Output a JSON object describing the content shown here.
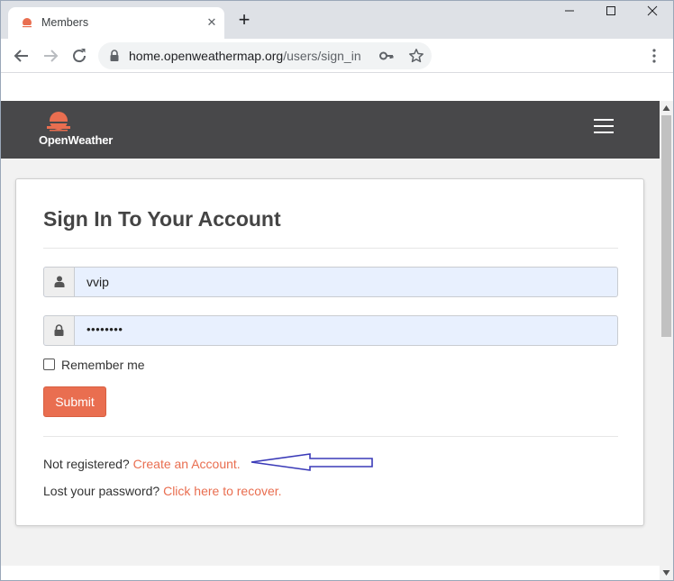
{
  "browser": {
    "tab_title": "Members",
    "url_domain": "home.openweathermap.org",
    "url_path": "/users/sign_in"
  },
  "site": {
    "logo_text": "OpenWeather",
    "brand_color": "#e96e50",
    "header_color": "#48484a"
  },
  "form": {
    "title": "Sign In To Your Account",
    "username_value": "vvip",
    "password_value": "••••••••",
    "remember_label": "Remember me",
    "submit_label": "Submit"
  },
  "footer_links": {
    "not_registered_text": "Not registered?",
    "create_account_link": "Create an Account.",
    "lost_password_text": "Lost your password?",
    "recover_link": "Click here to recover."
  }
}
